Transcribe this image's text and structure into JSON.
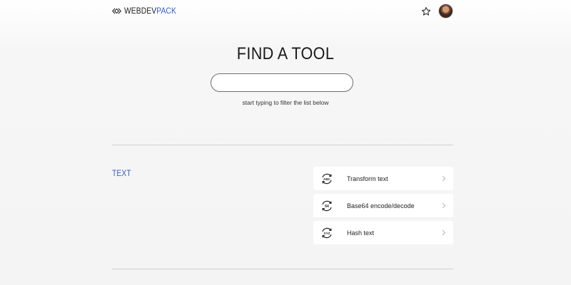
{
  "header": {
    "logo_part1": "WEBDEV",
    "logo_part2": "PACK",
    "logo_icon": "diamond-code-icon",
    "favorite_icon": "star-outline-icon",
    "avatar_icon": "user-avatar"
  },
  "hero": {
    "title": "FIND A TOOL",
    "search_value": "",
    "search_placeholder": "",
    "hint": "start typing to filter the list below"
  },
  "sections": [
    {
      "title": "TEXT",
      "tools": [
        {
          "label": "Transform text",
          "icon": "abc-cycle-icon",
          "icon_text": "ABC"
        },
        {
          "label": "Base64 encode/decode",
          "icon": "base64-cycle-icon",
          "icon_text": "64"
        },
        {
          "label": "Hash text",
          "icon": "xyz-cycle-icon",
          "icon_text": "XYZ"
        }
      ]
    }
  ],
  "colors": {
    "accent": "#2f5bd8",
    "text": "#222222",
    "divider": "#cfcfcf"
  }
}
